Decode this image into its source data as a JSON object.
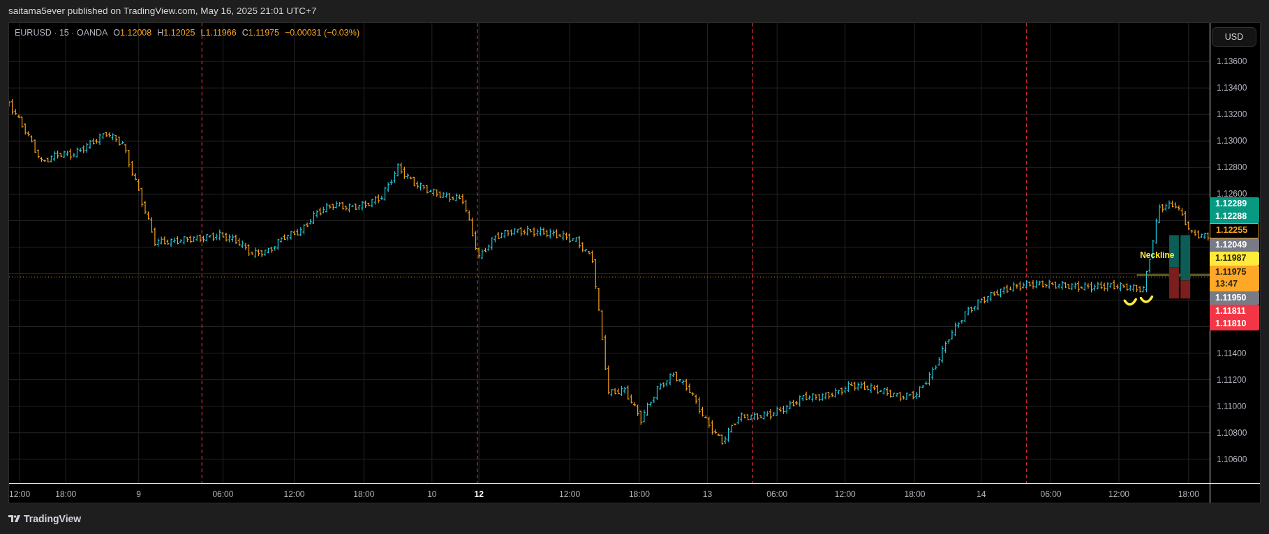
{
  "header": {
    "published_note": "saitama5ever published on TradingView.com, May 16, 2025 21:01 UTC+7"
  },
  "chart": {
    "legend": {
      "symbol": "EURUSD · 15 · OANDA",
      "color": "#f7a21b",
      "fields": [
        {
          "label": "O",
          "value": "1.12008"
        },
        {
          "label": "H",
          "value": "1.12025"
        },
        {
          "label": "L",
          "value": "1.11966"
        },
        {
          "label": "C",
          "value": "1.11975"
        }
      ],
      "change": "−0.00031 (−0.03%)"
    },
    "currency_button": "USD",
    "price_axis": [
      "1.13600",
      "1.13400",
      "1.13200",
      "1.13000",
      "1.12800",
      "1.12600",
      "1.11400",
      "1.11200",
      "1.11000",
      "1.10800",
      "1.10600"
    ],
    "price_badges": [
      {
        "lines": [
          "1.12289",
          "1.12288"
        ],
        "kind": "filled",
        "color": "#089981"
      },
      {
        "lines": [
          "1.12255"
        ],
        "kind": "outlined",
        "color": "#f7a21b"
      },
      {
        "lines": [
          "1.12049"
        ],
        "kind": "filled",
        "color": "#787b86"
      },
      {
        "lines": [
          "1.11987"
        ],
        "kind": "filled",
        "color": "#ffeb3b"
      },
      {
        "lines": [
          "1.11975",
          "13:47"
        ],
        "kind": "filled",
        "color": "#ffa726"
      },
      {
        "lines": [
          "1.11950"
        ],
        "kind": "filled",
        "color": "#787b86"
      },
      {
        "lines": [
          "1.11811",
          "1.11810"
        ],
        "kind": "filled",
        "color": "#f23645"
      }
    ],
    "time_axis": [
      {
        "label": "12:00",
        "bold": false
      },
      {
        "label": "18:00",
        "bold": false
      },
      {
        "label": "9",
        "bold": false
      },
      {
        "label": "06:00",
        "bold": false
      },
      {
        "label": "12:00",
        "bold": false
      },
      {
        "label": "18:00",
        "bold": false
      },
      {
        "label": "10",
        "bold": false
      },
      {
        "label": "12",
        "bold": true
      },
      {
        "label": "12:00",
        "bold": false
      },
      {
        "label": "18:00",
        "bold": false
      },
      {
        "label": "13",
        "bold": false
      },
      {
        "label": "06:00",
        "bold": false
      },
      {
        "label": "12:00",
        "bold": false
      },
      {
        "label": "18:00",
        "bold": false
      },
      {
        "label": "14",
        "bold": false
      },
      {
        "label": "06:00",
        "bold": false
      },
      {
        "label": "12:00",
        "bold": false
      },
      {
        "label": "18:00",
        "bold": false
      }
    ],
    "drawing_label": "Neckline"
  },
  "footer": {
    "brand": "TradingView"
  }
}
